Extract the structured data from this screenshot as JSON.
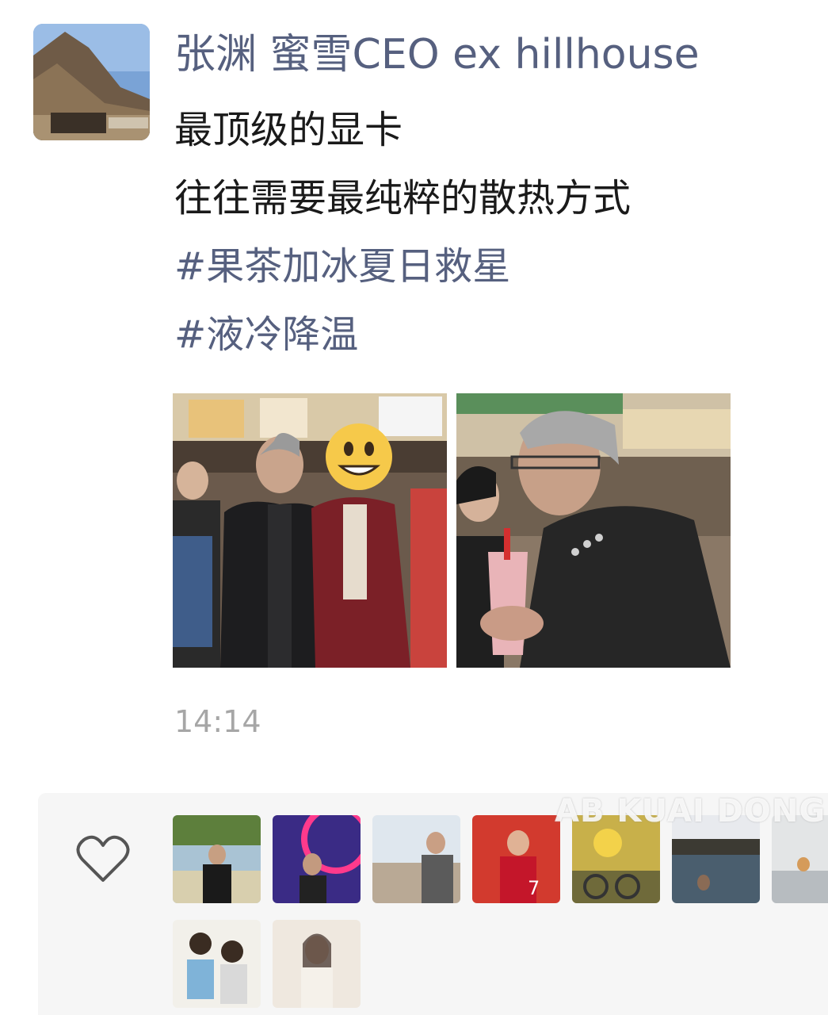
{
  "post": {
    "author": "张渊 蜜雪CEO ex hillhouse",
    "lines": [
      "最顶级的显卡",
      "往往需要最纯粹的散热方式"
    ],
    "hashtags": [
      "#果茶加冰夏日救星",
      "#液冷降温"
    ],
    "timestamp": "14:14"
  },
  "photos": [
    {
      "name": "group-photo"
    },
    {
      "name": "drink-photo"
    }
  ],
  "likes": {
    "icon": "heart-icon",
    "count_avatars": 9
  },
  "watermark": "AB KUAI DONG",
  "colors": {
    "author_blue": "#56607f",
    "text": "#1a1a1a",
    "timestamp_gray": "#a6a6a6",
    "likes_bg": "#f6f6f6"
  }
}
